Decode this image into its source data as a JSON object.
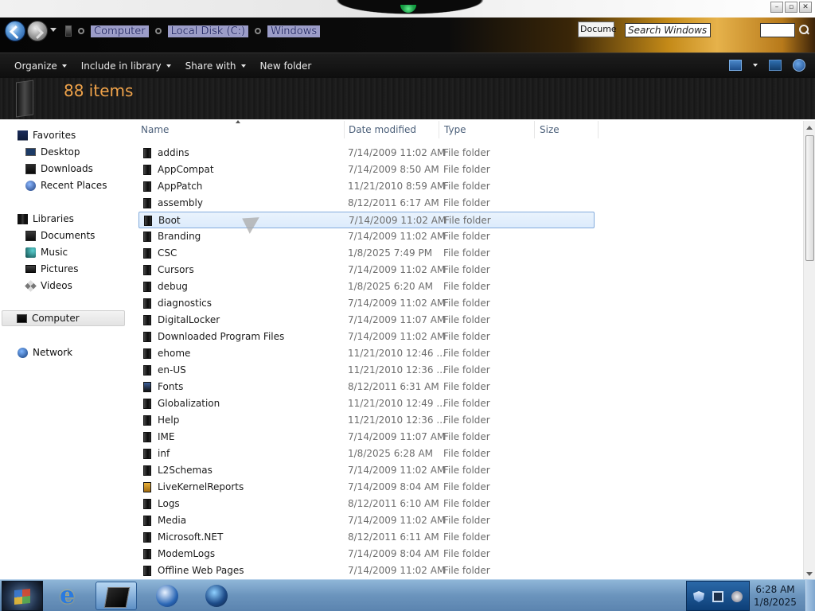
{
  "address": {
    "crumbs": [
      "Computer",
      "Local Disk (C:)",
      "Windows"
    ],
    "docs_chip": "Docume",
    "search_placeholder": "Search Windows"
  },
  "toolbar": {
    "organize": "Organize",
    "include_in_library": "Include in library",
    "share_with": "Share with",
    "new_folder": "New folder"
  },
  "header": {
    "items_count": "88 items"
  },
  "nav": {
    "favorites_label": "Favorites",
    "favorites": [
      "Desktop",
      "Downloads",
      "Recent Places"
    ],
    "libraries_label": "Libraries",
    "libraries": [
      "Documents",
      "Music",
      "Pictures",
      "Videos"
    ],
    "computer": "Computer",
    "network": "Network"
  },
  "columns": {
    "name": "Name",
    "date_modified": "Date modified",
    "type": "Type",
    "size": "Size"
  },
  "files": [
    {
      "name": "addins",
      "date": "7/14/2009 11:02 AM",
      "type": "File folder",
      "icon": "folder-icon"
    },
    {
      "name": "AppCompat",
      "date": "7/14/2009 8:50 AM",
      "type": "File folder",
      "icon": "folder-icon"
    },
    {
      "name": "AppPatch",
      "date": "11/21/2010 8:59 AM",
      "type": "File folder",
      "icon": "folder-icon"
    },
    {
      "name": "assembly",
      "date": "8/12/2011 6:17 AM",
      "type": "File folder",
      "icon": "folder-icon"
    },
    {
      "name": "Boot",
      "date": "7/14/2009 11:02 AM",
      "type": "File folder",
      "icon": "folder-icon",
      "selected": true
    },
    {
      "name": "Branding",
      "date": "7/14/2009 11:02 AM",
      "type": "File folder",
      "icon": "folder-icon"
    },
    {
      "name": "CSC",
      "date": "1/8/2025 7:49 PM",
      "type": "File folder",
      "icon": "folder-icon"
    },
    {
      "name": "Cursors",
      "date": "7/14/2009 11:02 AM",
      "type": "File folder",
      "icon": "folder-icon"
    },
    {
      "name": "debug",
      "date": "1/8/2025 6:20 AM",
      "type": "File folder",
      "icon": "folder-icon"
    },
    {
      "name": "diagnostics",
      "date": "7/14/2009 11:02 AM",
      "type": "File folder",
      "icon": "folder-icon"
    },
    {
      "name": "DigitalLocker",
      "date": "7/14/2009 11:07 AM",
      "type": "File folder",
      "icon": "folder-icon"
    },
    {
      "name": "Downloaded Program Files",
      "date": "7/14/2009 11:02 AM",
      "type": "File folder",
      "icon": "folder-icon"
    },
    {
      "name": "ehome",
      "date": "11/21/2010 12:46 ...",
      "type": "File folder",
      "icon": "folder-icon"
    },
    {
      "name": "en-US",
      "date": "11/21/2010 12:36 ...",
      "type": "File folder",
      "icon": "folder-icon"
    },
    {
      "name": "Fonts",
      "date": "8/12/2011 6:31 AM",
      "type": "File folder",
      "icon": "fonts-folder-icon"
    },
    {
      "name": "Globalization",
      "date": "11/21/2010 12:49 ...",
      "type": "File folder",
      "icon": "folder-icon"
    },
    {
      "name": "Help",
      "date": "11/21/2010 12:36 ...",
      "type": "File folder",
      "icon": "folder-icon"
    },
    {
      "name": "IME",
      "date": "7/14/2009 11:07 AM",
      "type": "File folder",
      "icon": "folder-icon"
    },
    {
      "name": "inf",
      "date": "1/8/2025 6:28 AM",
      "type": "File folder",
      "icon": "folder-icon"
    },
    {
      "name": "L2Schemas",
      "date": "7/14/2009 11:02 AM",
      "type": "File folder",
      "icon": "folder-icon"
    },
    {
      "name": "LiveKernelReports",
      "date": "7/14/2009 8:04 AM",
      "type": "File folder",
      "icon": "warning-folder-icon"
    },
    {
      "name": "Logs",
      "date": "8/12/2011 6:10 AM",
      "type": "File folder",
      "icon": "folder-icon"
    },
    {
      "name": "Media",
      "date": "7/14/2009 11:02 AM",
      "type": "File folder",
      "icon": "folder-icon"
    },
    {
      "name": "Microsoft.NET",
      "date": "8/12/2011 6:11 AM",
      "type": "File folder",
      "icon": "folder-icon"
    },
    {
      "name": "ModemLogs",
      "date": "7/14/2009 8:04 AM",
      "type": "File folder",
      "icon": "folder-icon"
    },
    {
      "name": "Offline Web Pages",
      "date": "7/14/2009 11:02 AM",
      "type": "File folder",
      "icon": "folder-icon"
    }
  ],
  "taskbar": {
    "time": "6:28 AM",
    "date": "1/8/2025"
  }
}
